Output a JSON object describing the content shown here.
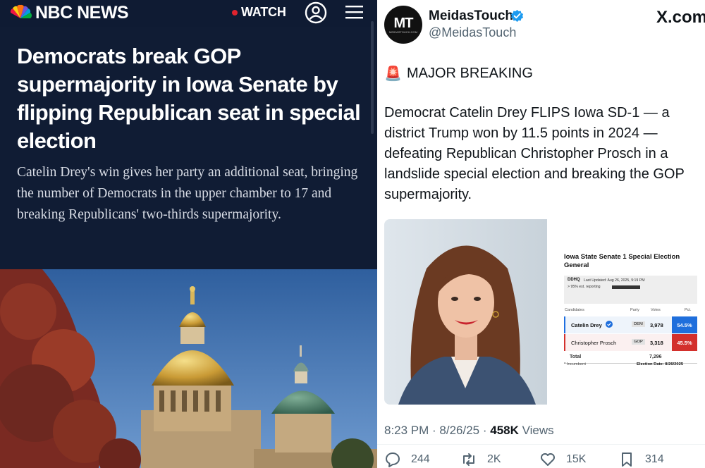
{
  "nbc": {
    "logo": "NBC NEWS",
    "watch": "WATCH",
    "headline": "Democrats break GOP supermajority in Iowa Senate by flipping Republican seat in special election",
    "dek": "Catelin Drey's win gives her party an additional seat, bringing the number of Democrats in the upper chamber to 17 and breaking Republicans' two-thirds supermajority."
  },
  "tweet": {
    "display_name": "MeidasTouch",
    "handle": "@MeidasTouch",
    "avatar_text": "MT",
    "avatar_sub": "MEIDASTOUCH.COM",
    "platform": "X.com",
    "alarm_emoji": "🚨",
    "headline": "MAJOR BREAKING",
    "body": "Democrat Catelin Drey FLIPS Iowa SD-1 — a district Trump won by 11.5 points in 2024 — defeating Republican Christopher Prosch in a landslide special election and breaking the GOP supermajority.",
    "time": "8:23 PM · 8/26/25 · ",
    "views_count": "458K",
    "views_label": " Views",
    "replies": "244",
    "reposts": "2K",
    "likes": "15K",
    "bookmarks": "314"
  },
  "results": {
    "title": "Iowa State Senate 1 Special Election General",
    "source": "DDHQ",
    "updated": "Last Updated: Aug 26, 2025, 9:19 PM",
    "reporting": "> 95% est. reporting",
    "headers": {
      "candidates": "Candidates",
      "party": "Party",
      "votes": "Votes",
      "pct": "Pct."
    },
    "rows": [
      {
        "name": "Catelin Drey",
        "party": "DEM",
        "votes": "3,978",
        "pct": "54.5%"
      },
      {
        "name": "Christopher Prosch",
        "party": "GOP",
        "votes": "3,318",
        "pct": "45.5%"
      }
    ],
    "total_label": "Total",
    "total_votes": "7,296",
    "incumbent_note": "* Incumbent",
    "election_date": "Election Date: 8/26/2025"
  },
  "colors": {
    "nbc_bg": "#101c34",
    "dem": "#1f6fdc",
    "gop": "#d3302c",
    "verified": "#1d9bf0"
  }
}
